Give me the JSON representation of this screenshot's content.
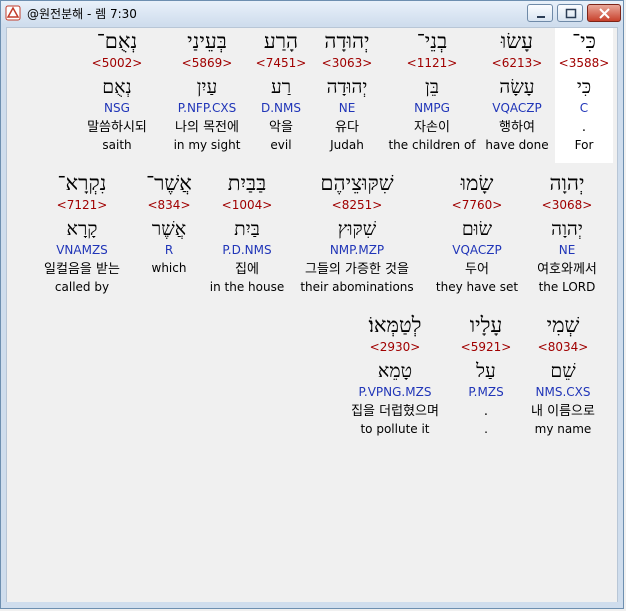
{
  "window": {
    "title": "@원전분해 - 렘 7:30"
  },
  "words": [
    {
      "hebrew": "כִּי־",
      "strong": "<3588>",
      "lemma": "כִּי",
      "morph": "C",
      "korean": ".",
      "english": "For",
      "highlight": true
    },
    {
      "hebrew": "עָשׂוּ",
      "strong": "<6213>",
      "lemma": "עָשָׂה",
      "morph": "VQACZP",
      "korean": "행하여",
      "english": "have done"
    },
    {
      "hebrew": "בְנֵי־",
      "strong": "<1121>",
      "lemma": "בֵּן",
      "morph": "NMPG",
      "korean": "자손이",
      "english": "the children of"
    },
    {
      "hebrew": "יְהוּדָה",
      "strong": "<3063>",
      "lemma": "יְהוּדָה",
      "morph": "NE",
      "korean": "유다",
      "english": "Judah"
    },
    {
      "hebrew": "הָרַע",
      "strong": "<7451>",
      "lemma": "רַע",
      "morph": "D.NMS",
      "korean": "악을",
      "english": "evil"
    },
    {
      "hebrew": "בְּעֵינַי",
      "strong": "<5869>",
      "lemma": "עַיִן",
      "morph": "P.NFP.CXS",
      "korean": "나의 목전에",
      "english": "in my sight"
    },
    {
      "hebrew": "נְאֻם־",
      "strong": "<5002>",
      "lemma": "נְאֻם",
      "morph": "NSG",
      "korean": "말씀하시되",
      "english": "saith"
    },
    {
      "hebrew": "יְהוָה",
      "strong": "<3068>",
      "lemma": "יְהוָה",
      "morph": "NE",
      "korean": "여호와께서",
      "english": "the LORD"
    },
    {
      "hebrew": "שָׂמוּ",
      "strong": "<7760>",
      "lemma": "שׂוּם",
      "morph": "VQACZP",
      "korean": "두어",
      "english": "they have set"
    },
    {
      "hebrew": "שִׁקּוּצֵיהֶם",
      "strong": "<8251>",
      "lemma": "שִׁקּוּץ",
      "morph": "NMP.MZP",
      "korean": "그들의 가증한 것을",
      "english": "their abominations"
    },
    {
      "hebrew": "בַּבַּיִת",
      "strong": "<1004>",
      "lemma": "בַּיִת",
      "morph": "P.D.NMS",
      "korean": "집에",
      "english": "in the house"
    },
    {
      "hebrew": "אֲשֶׁר־",
      "strong": "<834>",
      "lemma": "אֲשֶׁר",
      "morph": "R",
      "korean": "",
      "english": "which"
    },
    {
      "hebrew": "נִקְרָא־",
      "strong": "<7121>",
      "lemma": "קָרָא",
      "morph": "VNAMZS",
      "korean": "일컬음을 받는",
      "english": "called by"
    },
    {
      "hebrew": "שְׁמִי",
      "strong": "<8034>",
      "lemma": "שֵׁם",
      "morph": "NMS.CXS",
      "korean": "내 이름으로",
      "english": "my name"
    },
    {
      "hebrew": "עָלָיו",
      "strong": "<5921>",
      "lemma": "עַל",
      "morph": "P.MZS",
      "korean": ".",
      "english": "."
    },
    {
      "hebrew": "לְטַמְּאוֹ׃",
      "strong": "<2930>",
      "lemma": "טָמֵא",
      "morph": "P.VPNG.MZS",
      "korean": "집을 더럽혔으며",
      "english": "to pollute it"
    }
  ]
}
